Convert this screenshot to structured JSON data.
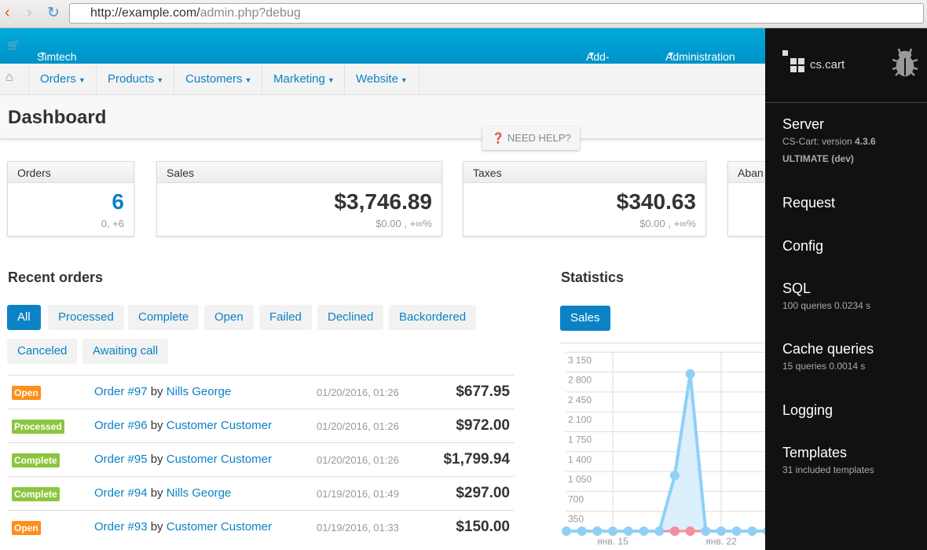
{
  "browser": {
    "url_host": "http://example.com/",
    "url_path": "admin.php?debug"
  },
  "topbar": {
    "store": "Simtech",
    "addons": "Add-ons",
    "administration": "Administration"
  },
  "menu": [
    "Orders",
    "Products",
    "Customers",
    "Marketing",
    "Website"
  ],
  "page": {
    "title": "Dashboard",
    "help": "NEED HELP?"
  },
  "cards": [
    {
      "label": "Orders",
      "value": "6",
      "sub": "0, +6"
    },
    {
      "label": "Sales",
      "value": "$3,746.89",
      "sub": "$0.00 , +∞%"
    },
    {
      "label": "Taxes",
      "value": "$340.63",
      "sub": "$0.00 , +∞%"
    },
    {
      "label": "Aban"
    }
  ],
  "recent": {
    "title": "Recent orders",
    "filters": [
      "All",
      "Processed",
      "Complete",
      "Open",
      "Failed",
      "Declined",
      "Backordered",
      "Canceled",
      "Awaiting call"
    ],
    "by": "by",
    "orders": [
      {
        "status": "Open",
        "order": "Order #97",
        "customer": "Nills George",
        "date": "01/20/2016, 01:26",
        "amount": "$677.95"
      },
      {
        "status": "Processed",
        "order": "Order #96",
        "customer": "Customer Customer",
        "date": "01/20/2016, 01:26",
        "amount": "$972.00"
      },
      {
        "status": "Complete",
        "order": "Order #95",
        "customer": "Customer Customer",
        "date": "01/20/2016, 01:26",
        "amount": "$1,799.94"
      },
      {
        "status": "Complete",
        "order": "Order #94",
        "customer": "Nills George",
        "date": "01/19/2016, 01:49",
        "amount": "$297.00"
      },
      {
        "status": "Open",
        "order": "Order #93",
        "customer": "Customer Customer",
        "date": "01/19/2016, 01:33",
        "amount": "$150.00"
      }
    ]
  },
  "statistics": {
    "title": "Statistics",
    "tab": "Sales"
  },
  "chart_data": {
    "type": "area",
    "yticks": [
      "3 150",
      "2 800",
      "2 450",
      "2 100",
      "1 750",
      "1 400",
      "1 050",
      "700",
      "350"
    ],
    "ylim": [
      0,
      3150
    ],
    "xticks": [
      "янв. 15",
      "янв. 22"
    ],
    "grid": true,
    "series": [
      {
        "color": "#8fd0f7",
        "values": [
          0,
          0,
          0,
          0,
          0,
          0,
          0,
          980,
          2770,
          0,
          0,
          0,
          0,
          0
        ]
      },
      {
        "color": "#f28ea0",
        "values": [
          0,
          0,
          0,
          0,
          0,
          0,
          0,
          0,
          0,
          0,
          0,
          0,
          0,
          0
        ]
      }
    ]
  },
  "debug": {
    "logo": "cs.cart",
    "server": "Server",
    "version_label": "CS-Cart: version ",
    "version": "4.3.6",
    "edition": "ULTIMATE (dev)",
    "request": "Request",
    "config": "Config",
    "sql": "SQL",
    "sql_info": "100 queries 0.0234 s",
    "cache": "Cache queries",
    "cache_info": "15 queries 0.0014 s",
    "logging": "Logging",
    "templates": "Templates",
    "templates_info": "31 included templates"
  }
}
